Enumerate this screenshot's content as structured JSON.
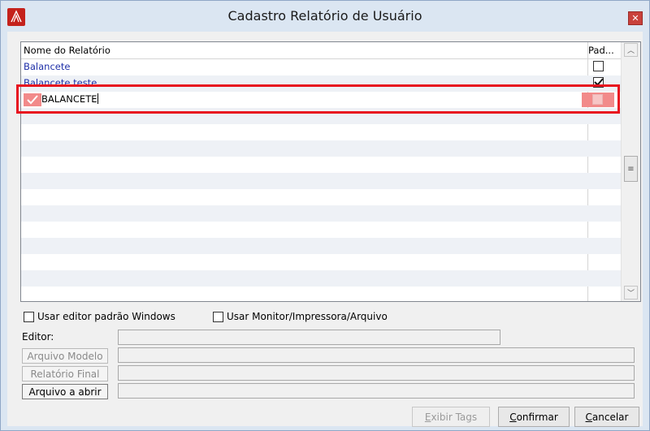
{
  "window": {
    "title": "Cadastro Relatório de Usuário"
  },
  "grid": {
    "columns": {
      "name": "Nome do Relatório",
      "pad": "Pad..."
    },
    "rows": [
      {
        "label": "Balancete",
        "checked": false
      },
      {
        "label": "Balancete teste",
        "checked": true
      }
    ],
    "edit_row": {
      "text": "BALANCETE"
    }
  },
  "options": {
    "windows_editor": "Usar editor padrão Windows",
    "monitor_printer": "Usar Monitor/Impressora/Arquivo"
  },
  "editor_label": "Editor:",
  "buttons": {
    "arquivo_modelo": "Arquivo Modelo",
    "relatorio_final": "Relatório Final",
    "arquivo_abrir": "Arquivo a abrir",
    "exibir_tags_first": "E",
    "exibir_tags_rest": "xibir Tags",
    "confirmar_first": "C",
    "confirmar_rest": "onfirmar",
    "cancelar_first": "C",
    "cancelar_rest": "ancelar"
  },
  "colors": {
    "highlight": "#e8121f",
    "edit_row": "#f28a8a",
    "link_text": "#1e2fa8"
  }
}
